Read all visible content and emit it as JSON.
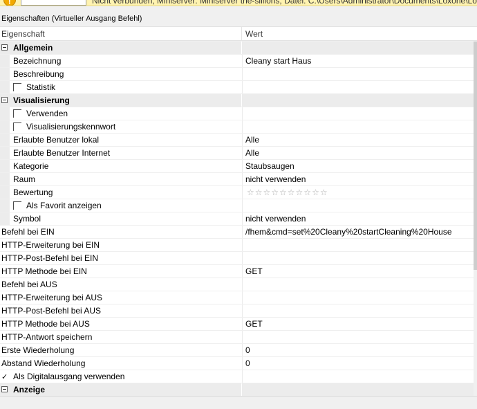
{
  "status_bar": {
    "text": "Nicht verbunden, Miniserver: Miniserver the-sillions, Datei: C:\\Users\\Administrator\\Documents\\Loxone\\Loxon"
  },
  "panel_title": "Eigenschaften (Virtueller Ausgang Befehl)",
  "header": {
    "property": "Eigenschaft",
    "value": "Wert"
  },
  "rows": [
    {
      "label": "Allgemein",
      "value": ""
    },
    {
      "label": "Bezeichnung",
      "value": "Cleany start Haus"
    },
    {
      "label": "Beschreibung",
      "value": ""
    },
    {
      "label": "Statistik",
      "value": ""
    },
    {
      "label": "Visualisierung",
      "value": ""
    },
    {
      "label": "Verwenden",
      "value": ""
    },
    {
      "label": "Visualisierungskennwort",
      "value": ""
    },
    {
      "label": "Erlaubte Benutzer lokal",
      "value": "Alle"
    },
    {
      "label": "Erlaubte Benutzer Internet",
      "value": "Alle"
    },
    {
      "label": "Kategorie",
      "value": "Staubsaugen"
    },
    {
      "label": "Raum",
      "value": "nicht verwenden"
    },
    {
      "label": "Bewertung",
      "value": "☆☆☆☆☆☆☆☆☆☆"
    },
    {
      "label": "Als Favorit anzeigen",
      "value": ""
    },
    {
      "label": "Symbol",
      "value": "nicht verwenden"
    },
    {
      "label": "Befehl bei EIN",
      "value": "/fhem&cmd=set%20Cleany%20startCleaning%20House"
    },
    {
      "label": "HTTP-Erweiterung bei EIN",
      "value": ""
    },
    {
      "label": "HTTP-Post-Befehl bei EIN",
      "value": ""
    },
    {
      "label": "HTTP Methode bei EIN",
      "value": "GET"
    },
    {
      "label": "Befehl bei AUS",
      "value": ""
    },
    {
      "label": "HTTP-Erweiterung bei AUS",
      "value": ""
    },
    {
      "label": "HTTP-Post-Befehl bei AUS",
      "value": ""
    },
    {
      "label": "HTTP Methode bei AUS",
      "value": "GET"
    },
    {
      "label": "HTTP-Antwort speichern",
      "value": ""
    },
    {
      "label": "Erste Wiederholung",
      "value": "0"
    },
    {
      "label": "Abstand Wiederholung",
      "value": "0"
    },
    {
      "label": "Als Digitalausgang verwenden",
      "value": ""
    },
    {
      "label": "Anzeige",
      "value": ""
    }
  ],
  "rating": {
    "value": 0,
    "max": 10
  },
  "checkboxes": {
    "statistik": false,
    "verwenden": false,
    "visualisierungskennwort": false,
    "als_favorit": false,
    "http_antwort": false,
    "als_digitalausgang": true
  }
}
